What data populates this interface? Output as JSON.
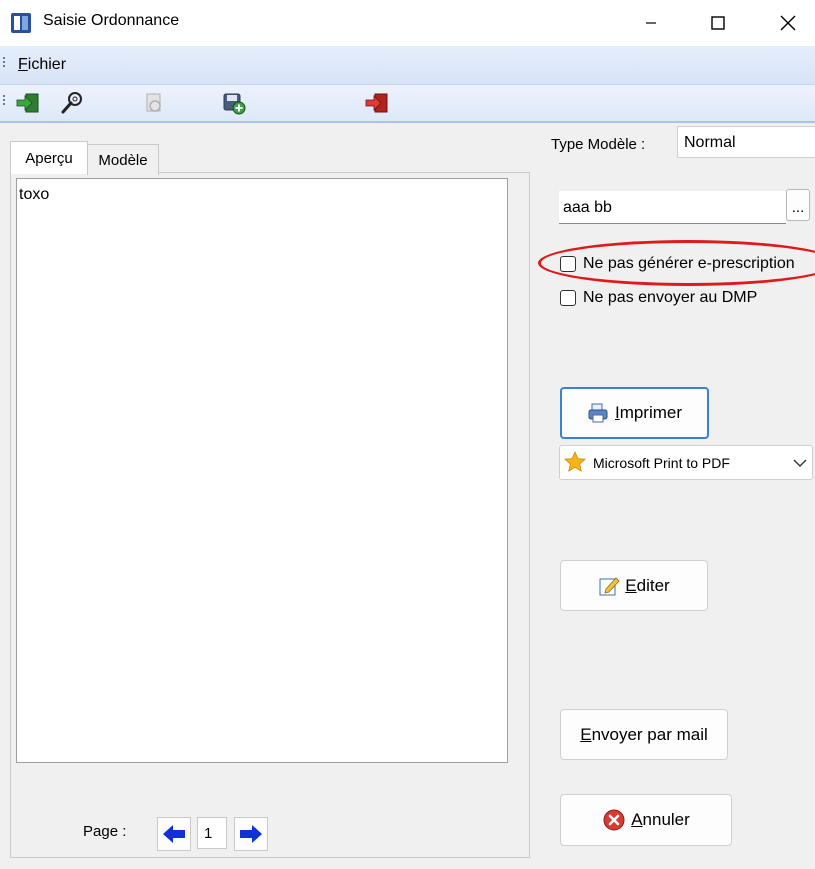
{
  "window": {
    "title": "Saisie Ordonnance"
  },
  "menu": {
    "items": [
      {
        "underline": "F",
        "rest": "ichier"
      }
    ]
  },
  "tabs": {
    "active": "Aperçu",
    "inactive": "Modèle"
  },
  "preview": {
    "text": "toxo"
  },
  "pager": {
    "label": "Page :",
    "value": "1"
  },
  "form": {
    "type_label": "Type Modèle :",
    "type_value": "Normal",
    "name_value": "aaa bb",
    "dots_label": "...",
    "chk_eprescription": "Ne pas générer e-prescription",
    "chk_dmp": "Ne pas envoyer au DMP"
  },
  "buttons": {
    "imprimer": {
      "underline": "I",
      "rest": "mprimer"
    },
    "printer": "Microsoft Print to PDF",
    "editer": {
      "underline": "E",
      "rest": "diter"
    },
    "envoyer": {
      "underline": "E",
      "rest": "nvoyer par mail"
    },
    "annuler": {
      "underline": "A",
      "rest": "nnuler"
    }
  },
  "colors": {
    "annotation": "#e01a1a",
    "focus_border": "#3b80d6",
    "nav_arrow": "#1030d8"
  }
}
